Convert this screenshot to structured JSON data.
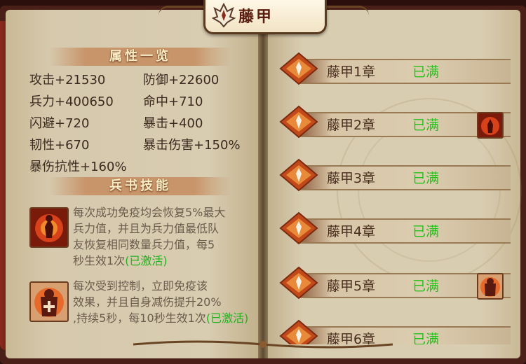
{
  "title": "藤甲",
  "attributes": {
    "header": "属性一览",
    "stats": [
      "攻击+21530",
      "防御+22600",
      "兵力+400650",
      "命中+710",
      "闪避+720",
      "暴击+400",
      "韧性+670",
      "暴击伤害+150%",
      "暴伤抗性+160%"
    ]
  },
  "skills": {
    "header": "兵书技能",
    "items": [
      {
        "icon": "fire-warrior-icon",
        "lines": [
          "每次成功免疫均会恢复5%最大",
          "兵力值，并且为兵力值最低队",
          "友恢复相同数量兵力值，每5",
          "秒生效1次"
        ],
        "status": "(已激活)"
      },
      {
        "icon": "armored-warrior-icon",
        "lines": [
          "每次受到控制，立即免疫该",
          "效果，并且自身减伤提升20%",
          ",持续5秒，每10秒生效1次"
        ],
        "status": "(已激活)"
      }
    ]
  },
  "chapters": [
    {
      "name": "藤甲1章",
      "status": "已满",
      "skill": ""
    },
    {
      "name": "藤甲2章",
      "status": "已满",
      "skill": "fire-warrior-icon"
    },
    {
      "name": "藤甲3章",
      "status": "已满",
      "skill": ""
    },
    {
      "name": "藤甲4章",
      "status": "已满",
      "skill": ""
    },
    {
      "name": "藤甲5章",
      "status": "已满",
      "skill": "armored-warrior-icon"
    },
    {
      "name": "藤甲6章",
      "status": "已满",
      "skill": ""
    }
  ],
  "colors": {
    "status_green": "#24c21b",
    "header_band": "#c8956a",
    "page_paper": "#d8ccb1"
  }
}
